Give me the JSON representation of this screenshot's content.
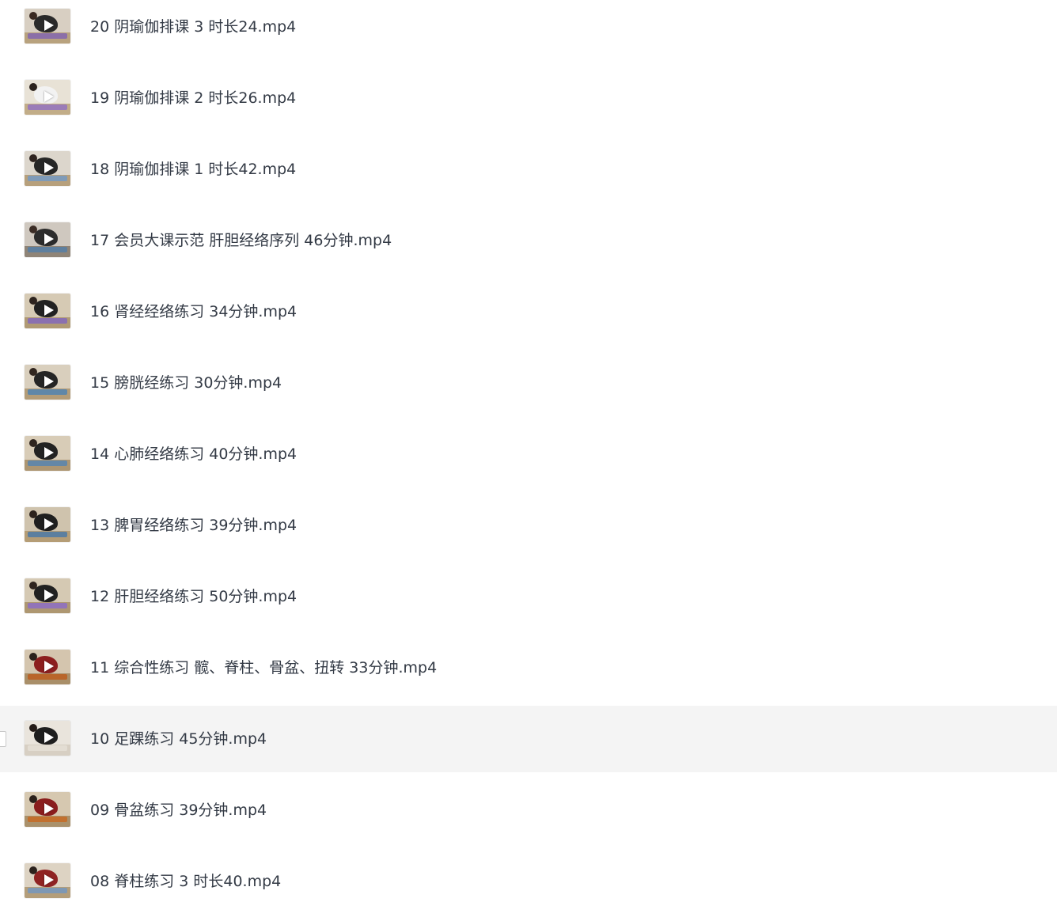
{
  "file_list": {
    "items": [
      {
        "name": "20 阴瑜伽排课 3 时长24.mp4",
        "icon": "video-thumbnail-icon",
        "hovered": false,
        "thumb": {
          "wall": "#d8cfc2",
          "floor": "#b8a27e",
          "mat": "#8b6fa8",
          "person": "#2a2a2a",
          "head": "#3a2a22"
        }
      },
      {
        "name": "19 阴瑜伽排课 2 时长26.mp4",
        "icon": "video-thumbnail-icon",
        "hovered": false,
        "thumb": {
          "wall": "#e8e2d6",
          "floor": "#c2ad88",
          "mat": "#9b7cb8",
          "person": "#f2f2f2",
          "head": "#2b221d"
        }
      },
      {
        "name": "18 阴瑜伽排课 1 时长42.mp4",
        "icon": "video-thumbnail-icon",
        "hovered": false,
        "thumb": {
          "wall": "#dcd6cc",
          "floor": "#b7a07c",
          "mat": "#7f9bb8",
          "person": "#262626",
          "head": "#2f2420"
        }
      },
      {
        "name": "17 会员大课示范 肝胆经络序列 46分钟.mp4",
        "icon": "video-thumbnail-icon",
        "hovered": false,
        "thumb": {
          "wall": "#cfc8bf",
          "floor": "#8f8477",
          "mat": "#5e7f9e",
          "person": "#2c2c2c",
          "head": "#3b2c25"
        }
      },
      {
        "name": "16 肾经经络练习 34分钟.mp4",
        "icon": "video-thumbnail-icon",
        "hovered": false,
        "thumb": {
          "wall": "#d6cab4",
          "floor": "#b09a74",
          "mat": "#8a70b0",
          "person": "#222222",
          "head": "#2e241f"
        }
      },
      {
        "name": "15 膀胱经练习 30分钟.mp4",
        "icon": "video-thumbnail-icon",
        "hovered": false,
        "thumb": {
          "wall": "#d9cfbd",
          "floor": "#b39c77",
          "mat": "#5f87a8",
          "person": "#252525",
          "head": "#31261f"
        }
      },
      {
        "name": "14 心肺经络练习 40分钟.mp4",
        "icon": "video-thumbnail-icon",
        "hovered": false,
        "thumb": {
          "wall": "#d8ccb7",
          "floor": "#ad9672",
          "mat": "#6487a6",
          "person": "#232323",
          "head": "#2f251f"
        }
      },
      {
        "name": "13 脾胃经络练习 39分钟.mp4",
        "icon": "video-thumbnail-icon",
        "hovered": false,
        "thumb": {
          "wall": "#cfc3ad",
          "floor": "#b59d76",
          "mat": "#5c7f9f",
          "person": "#1f1f1f",
          "head": "#2d231d"
        }
      },
      {
        "name": "12 肝胆经络练习 50分钟.mp4",
        "icon": "video-thumbnail-icon",
        "hovered": false,
        "thumb": {
          "wall": "#d5c9b3",
          "floor": "#ae9771",
          "mat": "#9274b8",
          "person": "#212121",
          "head": "#2f241e"
        }
      },
      {
        "name": "11 综合性练习 髋、脊柱、骨盆、扭转 33分钟.mp4",
        "icon": "video-thumbnail-icon",
        "hovered": false,
        "thumb": {
          "wall": "#d4c5ae",
          "floor": "#a98f69",
          "mat": "#b9652a",
          "person": "#8c1f1f",
          "head": "#2b211c"
        }
      },
      {
        "name": "10 足踝练习 45分钟.mp4",
        "icon": "video-thumbnail-icon",
        "hovered": true,
        "thumb": {
          "wall": "#e9e4dc",
          "floor": "#d7cfc3",
          "mat": "#e3ddd3",
          "person": "#1e1e1e",
          "head": "#241b17"
        }
      },
      {
        "name": "09 骨盆练习 39分钟.mp4",
        "icon": "video-thumbnail-icon",
        "hovered": false,
        "thumb": {
          "wall": "#d6c8b0",
          "floor": "#aa916b",
          "mat": "#c2702e",
          "person": "#8a1d1d",
          "head": "#2b211c"
        }
      },
      {
        "name": "08 脊柱练习 3 时长40.mp4",
        "icon": "video-thumbnail-icon",
        "hovered": false,
        "thumb": {
          "wall": "#ddd3c3",
          "floor": "#b49e7a",
          "mat": "#7e98b4",
          "person": "#8f2323",
          "head": "#2c221d"
        }
      }
    ]
  }
}
